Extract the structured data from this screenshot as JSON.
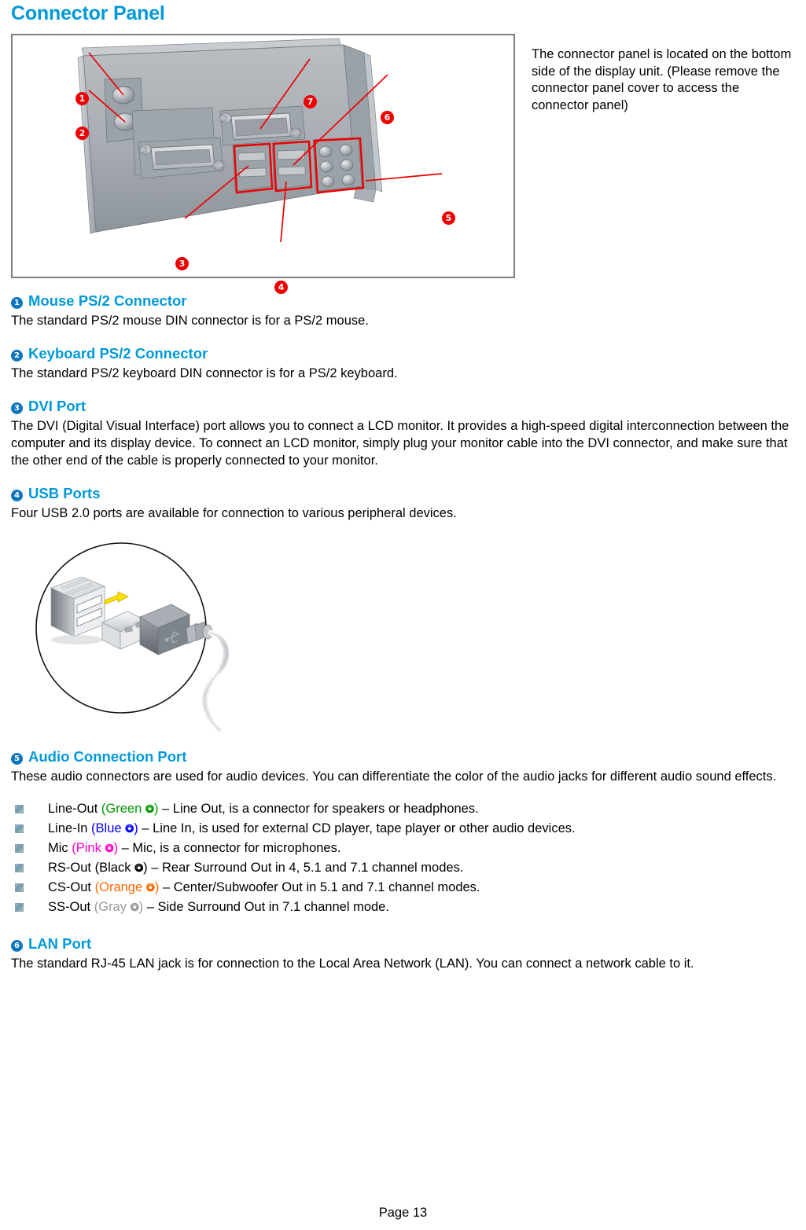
{
  "document": {
    "title": "Connector Panel",
    "page_footer": "Page 13"
  },
  "colors": {
    "heading_blue": "#0099D8",
    "badge_blue": "#0E76BC",
    "callout_red": "#EE0000",
    "box_border_gray": "#808080",
    "green": "#009900",
    "blue": "#0000FF",
    "pink": "#FF00CC",
    "black": "#000000",
    "orange": "#FF6600",
    "gray": "#999999"
  },
  "figure": {
    "name": "connector-panel-diagram",
    "callouts": [
      {
        "number": "1",
        "glyph": "❶"
      },
      {
        "number": "2",
        "glyph": "❷"
      },
      {
        "number": "3",
        "glyph": "❸"
      },
      {
        "number": "4",
        "glyph": "❹"
      },
      {
        "number": "5",
        "glyph": "❺"
      },
      {
        "number": "6",
        "glyph": "❻"
      },
      {
        "number": "7",
        "glyph": "❼"
      }
    ],
    "note": "The connector panel is located on the bottom side of the display unit. (Please remove the connector panel cover to access the connector panel)"
  },
  "sections": [
    {
      "number": "1",
      "heading": "Mouse PS/2 Connector",
      "body": "The standard PS/2 mouse DIN connector is for a PS/2 mouse."
    },
    {
      "number": "2",
      "heading": "Keyboard PS/2 Connector",
      "body": "The standard PS/2 keyboard DIN connector is for a PS/2 keyboard."
    },
    {
      "number": "3",
      "heading": "DVI Port",
      "body": "The DVI (Digital Visual Interface) port allows you to connect a LCD monitor. It provides a high-speed digital interconnection between the computer and its display device. To connect an LCD monitor, simply plug your monitor cable into the DVI connector, and make sure that the other end of the cable is properly connected to your monitor."
    },
    {
      "number": "4",
      "heading": "USB Ports",
      "body": "Four USB 2.0 ports are available for connection to various peripheral devices."
    },
    {
      "number": "5",
      "heading": "Audio Connection Port",
      "body": "These audio connectors are used for audio devices. You can differentiate the color of the audio jacks for different audio sound effects."
    },
    {
      "number": "6",
      "heading": "LAN Port",
      "body": "The standard RJ-45 LAN jack is for connection to the Local Area Network (LAN). You can connect a network cable to it."
    }
  ],
  "audio_jacks": [
    {
      "label": "Line-Out",
      "paren_open": "(",
      "color_name": "Green",
      "jack_glyph": "⭗",
      "paren_close": ")",
      "color_hex": "#009900",
      "description": " – Line Out, is a connector for speakers or headphones."
    },
    {
      "label": "Line-In",
      "paren_open": "(",
      "color_name": "Blue",
      "jack_glyph": "⭗",
      "paren_close": ")",
      "color_hex": "#0000FF",
      "description": " – Line In, is used for external CD player, tape player or other audio devices."
    },
    {
      "label": "Mic",
      "paren_open": "(",
      "color_name": "Pink",
      "jack_glyph": "⭗",
      "paren_close": ")",
      "color_hex": "#FF00CC",
      "description": " – Mic, is a connector for microphones."
    },
    {
      "label": "RS-Out",
      "paren_open": "(",
      "color_name": "Black",
      "jack_glyph": "⭗",
      "paren_close": ")",
      "color_hex": "#000000",
      "description": " – Rear Surround Out in 4, 5.1 and 7.1 channel modes."
    },
    {
      "label": "CS-Out",
      "paren_open": "(",
      "color_name": "Orange",
      "jack_glyph": "⭗",
      "paren_close": ")",
      "color_hex": "#FF6600",
      "description": " – Center/Subwoofer Out in 5.1 and 7.1 channel modes."
    },
    {
      "label": "SS-Out",
      "paren_open": "(",
      "color_name": "Gray",
      "jack_glyph": "⭗",
      "paren_close": ")",
      "color_hex": "#999999",
      "description": " – Side Surround Out in 7.1 channel mode."
    }
  ],
  "usb_figure": {
    "name": "usb-plug-illustration"
  }
}
